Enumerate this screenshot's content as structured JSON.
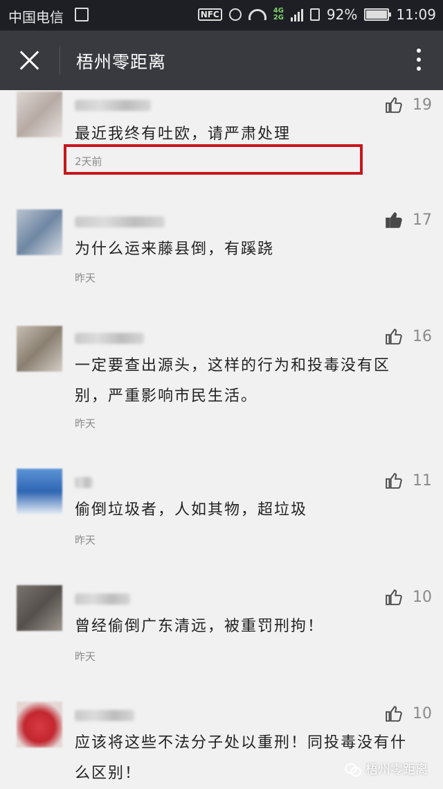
{
  "status_bar": {
    "carrier": "中国电信",
    "nfc": "NFC",
    "network_top": "4G",
    "network_bottom": "2G",
    "battery": "92%",
    "time": "11:09"
  },
  "nav": {
    "title": "梧州零距离"
  },
  "comments": [
    {
      "text": "最近我终有吐欧，请严肃处理",
      "time": "2天前",
      "likes": "19",
      "avatar_color": "#cfc6c2"
    },
    {
      "text": "为什么运来藤县倒，有蹊跷",
      "time": "昨天",
      "likes": "17",
      "avatar_color": "#8f9aa8",
      "highlighted": true
    },
    {
      "text": "一定要查出源头，这样的行为和投毒没有区别，严重影响市民生活。",
      "time": "昨天",
      "likes": "16",
      "avatar_color": "#a39a8a"
    },
    {
      "text": "偷倒垃圾者，人如其物，超垃圾",
      "time": "昨天",
      "likes": "11",
      "avatar_color": "#3f78c5"
    },
    {
      "text": "曾经偷倒广东清远，被重罚刑拘！",
      "time": "昨天",
      "likes": "10",
      "avatar_color": "#6d6863"
    },
    {
      "text": "应该将这些不法分子处以重刑！同投毒没有什么区别！",
      "time": "",
      "likes": "10",
      "avatar_color": "#c9333c"
    }
  ],
  "watermark": "梧州零距离",
  "icons": [
    "close-icon",
    "more-icon",
    "thumbs-up-icon",
    "alarm-icon",
    "wifi-icon",
    "battery-icon",
    "wechat-icon"
  ]
}
